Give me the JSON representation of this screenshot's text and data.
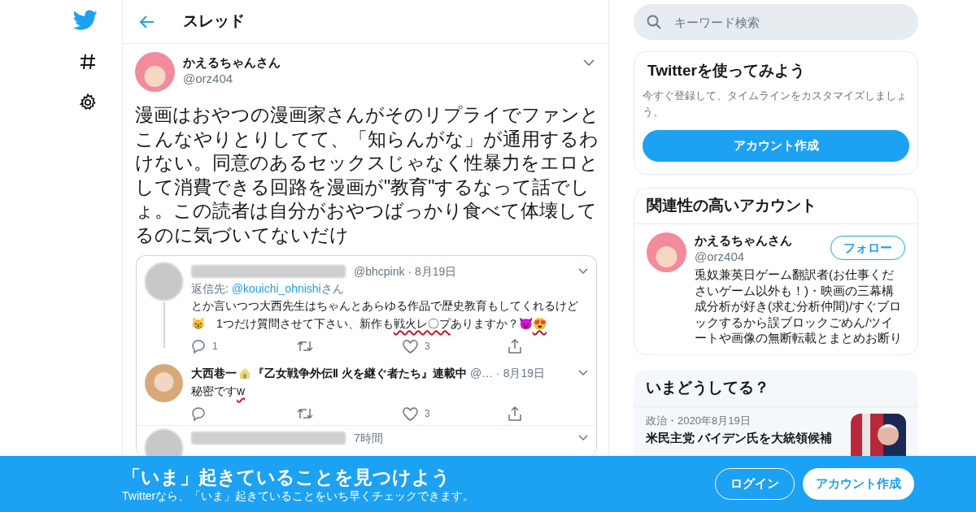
{
  "header": {
    "title": "スレッド"
  },
  "tweet": {
    "name": "かえるちゃんさん",
    "handle": "@orz404",
    "text": "漫画はおやつの漫画家さんがそのリプライでファンとこんなやりとりしてて、「知らんがな」が通用するわけない。同意のあるセックスじゃなく性暴力をエロとして消費できる回路を漫画が\"教育\"するなって話でしょ。この読者は自分がおやつばっかり食べて体壊してるのに気づいてないだけ"
  },
  "embedded_screenshot": {
    "tweets": [
      {
        "kind": "redacted",
        "handle": "@bhcpink",
        "time": "· 8月19日",
        "reply_to_label": "返信先: ",
        "reply_to": "@kouichi_ohnishi",
        "reply_to_suffix": "さん",
        "segments": [
          {
            "text": "とか言いつつ大西先生はちゃんとあらゆる作品で歴史教育もしてくれるけど😸　1つだけ質問させて下さい、新作も",
            "marked": false
          },
          {
            "text": "戦火レ〇プ",
            "marked": true
          },
          {
            "text": "ありますか？😈",
            "marked": false
          },
          {
            "text": "😍",
            "marked": true
          }
        ],
        "replies": "1",
        "likes": "3",
        "thread_line": true
      },
      {
        "kind": "named",
        "name": "大西巷一",
        "title": "『乙女戦争外伝Ⅱ 火を継ぐ者たち』連載中",
        "handle": "@…",
        "time": "· 8月19日",
        "segments": [
          {
            "text": "秘密です",
            "marked": false
          },
          {
            "text": "w",
            "marked": true
          }
        ],
        "likes": "3",
        "thread_line": false
      },
      {
        "kind": "redacted",
        "time": "7時間",
        "thread_line": false
      }
    ]
  },
  "search": {
    "placeholder": "キーワード検索"
  },
  "signup_card": {
    "title": "Twitterを使ってみよう",
    "text": "今すぐ登録して、タイムラインをカスタマイズしましょう。",
    "button": "アカウント作成"
  },
  "related": {
    "title": "関連性の高いアカウント",
    "account": {
      "name": "かえるちゃんさん",
      "handle": "@orz404",
      "button": "フォロー",
      "bio": "兎奴兼英日ゲーム翻訳者(お仕事くださいゲーム以外も！)・映画の三幕構成分析が好き(求む分析仲間)/すぐブロックするから誤ブロックごめん/ツイートや画像の無断転載とまとめお断り"
    }
  },
  "trends": {
    "title": "いまどうしてる？",
    "items": [
      {
        "meta": "政治・2020年8月19日",
        "headline": "米民主党 バイデン氏を大統領候補"
      }
    ]
  },
  "banner": {
    "title": "「いま」起きていることを見つけよう",
    "subtitle": "Twitterなら、「いま」起きていることをいち早くチェックできます。",
    "login": "ログイン",
    "signup": "アカウント作成"
  }
}
